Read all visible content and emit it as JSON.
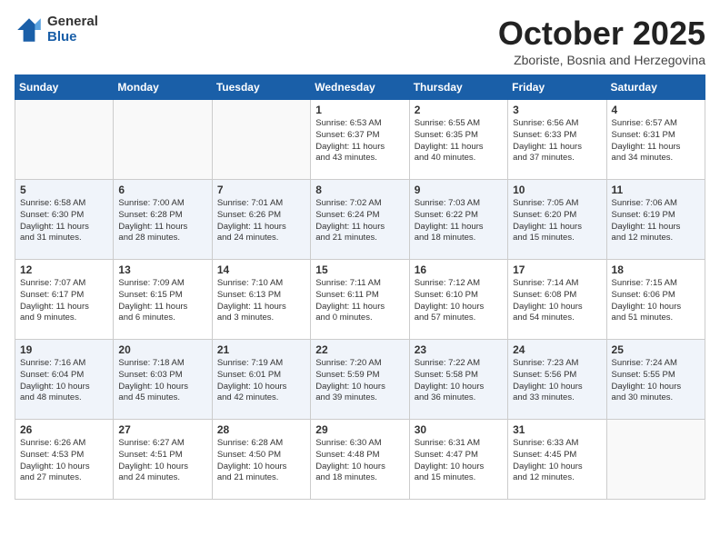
{
  "header": {
    "logo_general": "General",
    "logo_blue": "Blue",
    "month": "October 2025",
    "location": "Zboriste, Bosnia and Herzegovina"
  },
  "weekdays": [
    "Sunday",
    "Monday",
    "Tuesday",
    "Wednesday",
    "Thursday",
    "Friday",
    "Saturday"
  ],
  "weeks": [
    [
      {
        "day": "",
        "info": ""
      },
      {
        "day": "",
        "info": ""
      },
      {
        "day": "",
        "info": ""
      },
      {
        "day": "1",
        "info": "Sunrise: 6:53 AM\nSunset: 6:37 PM\nDaylight: 11 hours\nand 43 minutes."
      },
      {
        "day": "2",
        "info": "Sunrise: 6:55 AM\nSunset: 6:35 PM\nDaylight: 11 hours\nand 40 minutes."
      },
      {
        "day": "3",
        "info": "Sunrise: 6:56 AM\nSunset: 6:33 PM\nDaylight: 11 hours\nand 37 minutes."
      },
      {
        "day": "4",
        "info": "Sunrise: 6:57 AM\nSunset: 6:31 PM\nDaylight: 11 hours\nand 34 minutes."
      }
    ],
    [
      {
        "day": "5",
        "info": "Sunrise: 6:58 AM\nSunset: 6:30 PM\nDaylight: 11 hours\nand 31 minutes."
      },
      {
        "day": "6",
        "info": "Sunrise: 7:00 AM\nSunset: 6:28 PM\nDaylight: 11 hours\nand 28 minutes."
      },
      {
        "day": "7",
        "info": "Sunrise: 7:01 AM\nSunset: 6:26 PM\nDaylight: 11 hours\nand 24 minutes."
      },
      {
        "day": "8",
        "info": "Sunrise: 7:02 AM\nSunset: 6:24 PM\nDaylight: 11 hours\nand 21 minutes."
      },
      {
        "day": "9",
        "info": "Sunrise: 7:03 AM\nSunset: 6:22 PM\nDaylight: 11 hours\nand 18 minutes."
      },
      {
        "day": "10",
        "info": "Sunrise: 7:05 AM\nSunset: 6:20 PM\nDaylight: 11 hours\nand 15 minutes."
      },
      {
        "day": "11",
        "info": "Sunrise: 7:06 AM\nSunset: 6:19 PM\nDaylight: 11 hours\nand 12 minutes."
      }
    ],
    [
      {
        "day": "12",
        "info": "Sunrise: 7:07 AM\nSunset: 6:17 PM\nDaylight: 11 hours\nand 9 minutes."
      },
      {
        "day": "13",
        "info": "Sunrise: 7:09 AM\nSunset: 6:15 PM\nDaylight: 11 hours\nand 6 minutes."
      },
      {
        "day": "14",
        "info": "Sunrise: 7:10 AM\nSunset: 6:13 PM\nDaylight: 11 hours\nand 3 minutes."
      },
      {
        "day": "15",
        "info": "Sunrise: 7:11 AM\nSunset: 6:11 PM\nDaylight: 11 hours\nand 0 minutes."
      },
      {
        "day": "16",
        "info": "Sunrise: 7:12 AM\nSunset: 6:10 PM\nDaylight: 10 hours\nand 57 minutes."
      },
      {
        "day": "17",
        "info": "Sunrise: 7:14 AM\nSunset: 6:08 PM\nDaylight: 10 hours\nand 54 minutes."
      },
      {
        "day": "18",
        "info": "Sunrise: 7:15 AM\nSunset: 6:06 PM\nDaylight: 10 hours\nand 51 minutes."
      }
    ],
    [
      {
        "day": "19",
        "info": "Sunrise: 7:16 AM\nSunset: 6:04 PM\nDaylight: 10 hours\nand 48 minutes."
      },
      {
        "day": "20",
        "info": "Sunrise: 7:18 AM\nSunset: 6:03 PM\nDaylight: 10 hours\nand 45 minutes."
      },
      {
        "day": "21",
        "info": "Sunrise: 7:19 AM\nSunset: 6:01 PM\nDaylight: 10 hours\nand 42 minutes."
      },
      {
        "day": "22",
        "info": "Sunrise: 7:20 AM\nSunset: 5:59 PM\nDaylight: 10 hours\nand 39 minutes."
      },
      {
        "day": "23",
        "info": "Sunrise: 7:22 AM\nSunset: 5:58 PM\nDaylight: 10 hours\nand 36 minutes."
      },
      {
        "day": "24",
        "info": "Sunrise: 7:23 AM\nSunset: 5:56 PM\nDaylight: 10 hours\nand 33 minutes."
      },
      {
        "day": "25",
        "info": "Sunrise: 7:24 AM\nSunset: 5:55 PM\nDaylight: 10 hours\nand 30 minutes."
      }
    ],
    [
      {
        "day": "26",
        "info": "Sunrise: 6:26 AM\nSunset: 4:53 PM\nDaylight: 10 hours\nand 27 minutes."
      },
      {
        "day": "27",
        "info": "Sunrise: 6:27 AM\nSunset: 4:51 PM\nDaylight: 10 hours\nand 24 minutes."
      },
      {
        "day": "28",
        "info": "Sunrise: 6:28 AM\nSunset: 4:50 PM\nDaylight: 10 hours\nand 21 minutes."
      },
      {
        "day": "29",
        "info": "Sunrise: 6:30 AM\nSunset: 4:48 PM\nDaylight: 10 hours\nand 18 minutes."
      },
      {
        "day": "30",
        "info": "Sunrise: 6:31 AM\nSunset: 4:47 PM\nDaylight: 10 hours\nand 15 minutes."
      },
      {
        "day": "31",
        "info": "Sunrise: 6:33 AM\nSunset: 4:45 PM\nDaylight: 10 hours\nand 12 minutes."
      },
      {
        "day": "",
        "info": ""
      }
    ]
  ]
}
